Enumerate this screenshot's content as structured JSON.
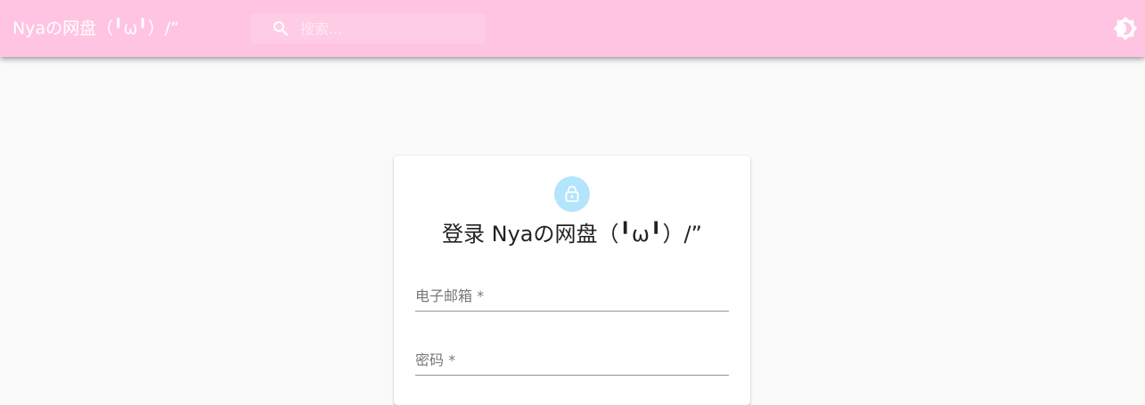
{
  "appbar": {
    "title": "Nyaの网盘（╹ω╹）/”",
    "search_placeholder": "搜索...",
    "background_color": "#ffc4e1",
    "theme_icon": "brightness-icon"
  },
  "login_card": {
    "avatar_icon": "lock-icon",
    "avatar_color": "#b3e5fc",
    "title": "登录 Nyaの网盘（╹ω╹）/”",
    "email_label": "电子邮箱 *",
    "password_label": "密码 *"
  }
}
